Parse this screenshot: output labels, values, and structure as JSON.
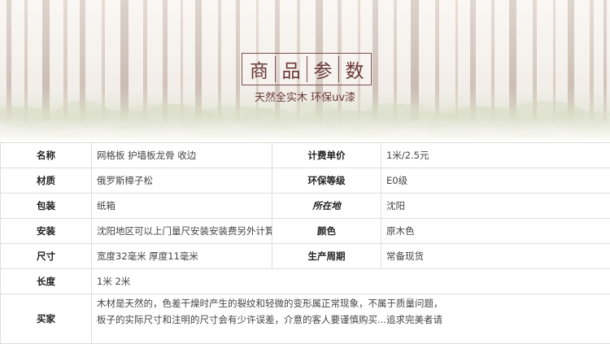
{
  "banner": {
    "title_chars": [
      "商",
      "品",
      "参",
      "数"
    ],
    "subtitle": "天然全实木  环保uv漆"
  },
  "specs": [
    {
      "k1": "名称",
      "v1": "网格板 护墙板龙骨 收边",
      "k2": "计费单价",
      "v2": "1米/2.5元"
    },
    {
      "k1": "材质",
      "v1": "俄罗斯樟子松",
      "k2": "环保等级",
      "v2": "E0级"
    },
    {
      "k1": "包装",
      "v1": "纸箱",
      "k2": "所在地",
      "v2": "沈阳"
    },
    {
      "k1": "安装",
      "v1": "沈阳地区可以上门量尺安装安装费另外计算",
      "k2": "颜色",
      "v2": "原木色"
    },
    {
      "k1": "尺寸",
      "v1": "宽度32毫米  厚度11毫米",
      "k2": "生产周期",
      "v2": "常备现货"
    }
  ],
  "length": {
    "label": "长度",
    "value": "1米  2米"
  },
  "notice": {
    "label": "买家",
    "line1": "木材是天然的，色差干燥时产生的裂纹和轻微的变形属正常现象，不属于质量问题，",
    "line2": "板子的实际尺寸和注明的尺寸会有少许误差，介意的客人要谨慎购买...追求完美者请"
  }
}
